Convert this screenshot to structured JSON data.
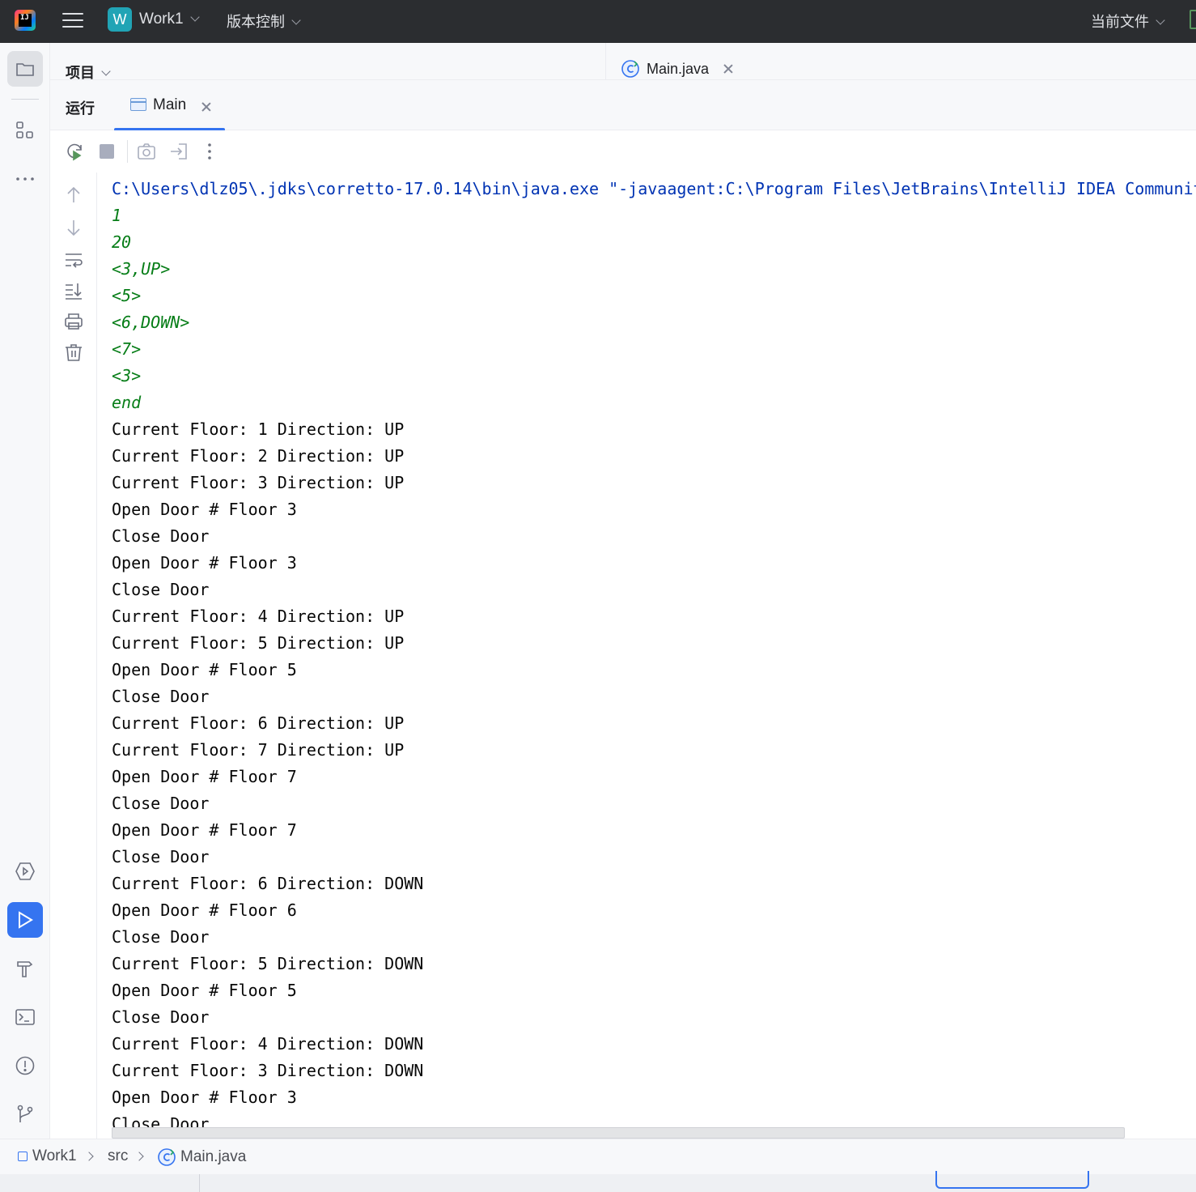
{
  "titlebar": {
    "ide_logo_text": "IJ",
    "project_badge": "W",
    "project_name": "Work1",
    "vcs_label": "版本控制",
    "current_file_label": "当前文件"
  },
  "project_panel": {
    "label": "项目"
  },
  "editor_tab": {
    "label": "Main.java"
  },
  "run_panel": {
    "title": "运行",
    "tab_label": "Main"
  },
  "console": {
    "lines": [
      {
        "text": "C:\\Users\\dlz05\\.jdks\\corretto-17.0.14\\bin\\java.exe \"-javaagent:C:\\Program Files\\JetBrains\\IntelliJ IDEA Communit",
        "kind": "cmd"
      },
      {
        "text": "1",
        "kind": "input"
      },
      {
        "text": "20",
        "kind": "input"
      },
      {
        "text": "<3,UP>",
        "kind": "input"
      },
      {
        "text": "<5>",
        "kind": "input"
      },
      {
        "text": "<6,DOWN>",
        "kind": "input"
      },
      {
        "text": "<7>",
        "kind": "input"
      },
      {
        "text": "<3>",
        "kind": "input"
      },
      {
        "text": "end",
        "kind": "input"
      },
      {
        "text": "Current Floor: 1 Direction: UP",
        "kind": "out"
      },
      {
        "text": "Current Floor: 2 Direction: UP",
        "kind": "out"
      },
      {
        "text": "Current Floor: 3 Direction: UP",
        "kind": "out"
      },
      {
        "text": "Open Door # Floor 3",
        "kind": "out"
      },
      {
        "text": "Close Door",
        "kind": "out"
      },
      {
        "text": "Open Door # Floor 3",
        "kind": "out"
      },
      {
        "text": "Close Door",
        "kind": "out"
      },
      {
        "text": "Current Floor: 4 Direction: UP",
        "kind": "out"
      },
      {
        "text": "Current Floor: 5 Direction: UP",
        "kind": "out"
      },
      {
        "text": "Open Door # Floor 5",
        "kind": "out"
      },
      {
        "text": "Close Door",
        "kind": "out"
      },
      {
        "text": "Current Floor: 6 Direction: UP",
        "kind": "out"
      },
      {
        "text": "Current Floor: 7 Direction: UP",
        "kind": "out"
      },
      {
        "text": "Open Door # Floor 7",
        "kind": "out"
      },
      {
        "text": "Close Door",
        "kind": "out"
      },
      {
        "text": "Open Door # Floor 7",
        "kind": "out"
      },
      {
        "text": "Close Door",
        "kind": "out"
      },
      {
        "text": "Current Floor: 6 Direction: DOWN",
        "kind": "out"
      },
      {
        "text": "Open Door # Floor 6",
        "kind": "out"
      },
      {
        "text": "Close Door",
        "kind": "out"
      },
      {
        "text": "Current Floor: 5 Direction: DOWN",
        "kind": "out"
      },
      {
        "text": "Open Door # Floor 5",
        "kind": "out"
      },
      {
        "text": "Close Door",
        "kind": "out"
      },
      {
        "text": "Current Floor: 4 Direction: DOWN",
        "kind": "out"
      },
      {
        "text": "Current Floor: 3 Direction: DOWN",
        "kind": "out"
      },
      {
        "text": "Open Door # Floor 3",
        "kind": "out"
      },
      {
        "text": "Close Door",
        "kind": "out"
      }
    ]
  },
  "breadcrumb": {
    "module": "Work1",
    "folder": "src",
    "file": "Main.java"
  },
  "icons": {
    "left_strip": [
      "folder-icon",
      "structure-icon",
      "more-icon",
      "services-icon",
      "run-icon",
      "build-icon",
      "terminal-icon",
      "problems-icon",
      "git-icon"
    ],
    "run_toolbar": [
      "rerun-icon",
      "stop-icon",
      "screenshot-icon",
      "exit-icon",
      "more-vertical-icon"
    ],
    "console_side": [
      "arrow-up-icon",
      "arrow-down-icon",
      "soft-wrap-icon",
      "scroll-to-end-icon",
      "print-icon",
      "trash-icon"
    ]
  },
  "colors": {
    "accent": "#3574f0",
    "command_text": "#0033b3",
    "input_text": "#067d17",
    "output_text": "#080808",
    "titlebar_bg": "#2b2d30"
  }
}
